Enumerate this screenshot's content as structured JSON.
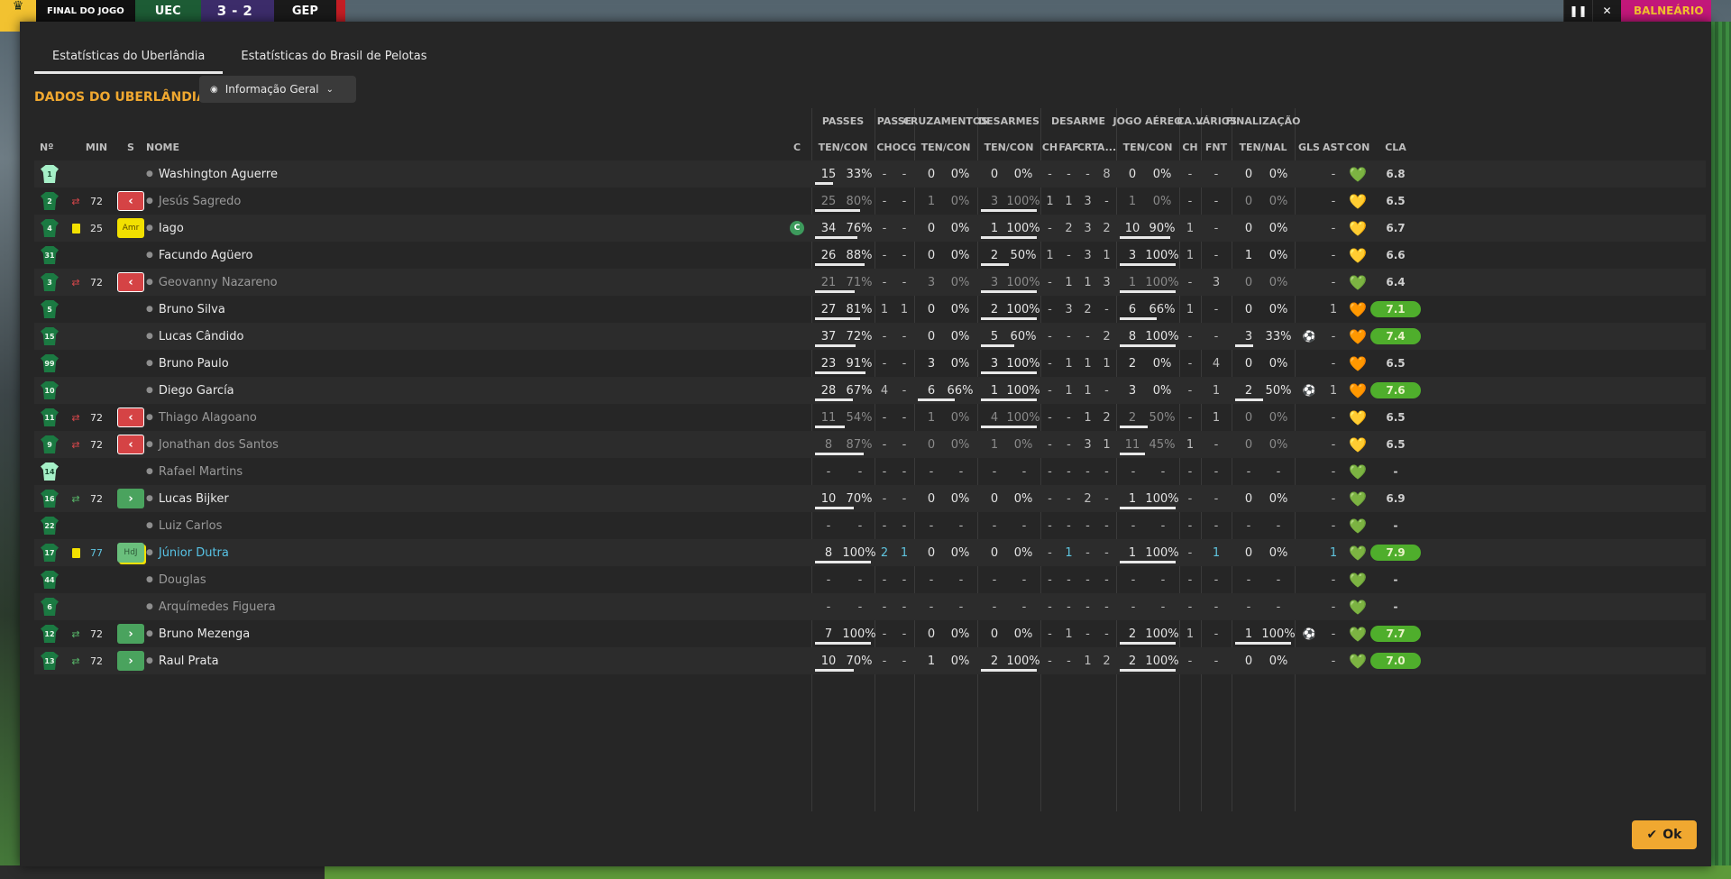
{
  "scorebar": {
    "status": "FINAL DO JOGO",
    "home": "UEC",
    "score": "3-2",
    "away": "GEP",
    "right_label": "BALNEÁRIO"
  },
  "tabs": [
    {
      "label": "Estatísticas do Uberlândia"
    },
    {
      "label": "Estatísticas do Brasil de Pelotas"
    }
  ],
  "section_title": "DADOS DO UBERLÂNDIA",
  "view_select": "Informação Geral",
  "ok_label": "Ok",
  "group_headers": {
    "passes": "PASSES",
    "passe": "PASSE",
    "cruzamentos": "CRUZAMENTOS",
    "desarmes": "DESARMES",
    "desarme": "DESARME",
    "jogo_aereo": "JOGO AÉREO",
    "ca": "CA...",
    "varios": "VÁRIOS",
    "finalizacao": "FINALIZAÇÃO"
  },
  "columns": {
    "num": "Nº",
    "min": "MIN",
    "s": "S",
    "nome": "NOME",
    "c": "C",
    "pas_tc": "TEN/CON",
    "pas_ch": "CH",
    "pas_ocg": "OCG",
    "cru_tc": "TEN/CON",
    "des_tc": "TEN/CON",
    "dm_ch": "CH",
    "dm_faf": "FAF",
    "dm_crt": "CRT",
    "dm_a": "A...",
    "aer_tc": "TEN/CON",
    "ca_ch": "CH",
    "var_fnt": "FNT",
    "fin_tn": "TEN/NAL",
    "gls": "GLS",
    "ast": "AST",
    "con": "CON",
    "cla": "CLA"
  },
  "colors": {
    "accent": "#f0a830",
    "rating_good": "#4fae2c",
    "sub_out": "#d54345",
    "sub_in": "#4aa35e",
    "link": "#57c3e6"
  },
  "rows": [
    {
      "num": "1",
      "gk": true,
      "name": "Washington Aguerre",
      "pt": "15",
      "pp": "33%",
      "pbar": 0.33,
      "pch": "-",
      "pocg": "-",
      "ct": "0",
      "cp": "0%",
      "dt": "0",
      "dp": "0%",
      "dch": "-",
      "dfaf": "-",
      "dcrt": "-",
      "da": "8",
      "at": "0",
      "ap": "0%",
      "cach": "-",
      "fnt": "-",
      "ft": "0",
      "fp": "0%",
      "gls": "",
      "ast": "-",
      "con": "💚",
      "conc": "#3ddc6b",
      "cla": "6.8"
    },
    {
      "num": "2",
      "sub": "out",
      "min": "72",
      "badge": "out",
      "badge_label": "‹",
      "name": "Jesús Sagredo",
      "dim": true,
      "pt": "25",
      "pp": "80%",
      "pbar": 0.8,
      "pch": "-",
      "pocg": "-",
      "ct": "1",
      "cp": "0%",
      "dt": "3",
      "dp": "100%",
      "dbar": 1,
      "dch": "1",
      "dfaf": "1",
      "dcrt": "3",
      "da": "-",
      "at": "1",
      "ap": "0%",
      "cach": "-",
      "fnt": "-",
      "ft": "0",
      "fp": "0%",
      "gls": "",
      "ast": "-",
      "con": "💛",
      "conc": "#b8d93a",
      "cla": "6.5"
    },
    {
      "num": "4",
      "yc": true,
      "min": "25",
      "badge": "amr",
      "badge_label": "Amr",
      "name": "Iago",
      "captain": "C",
      "pt": "34",
      "pp": "76%",
      "pbar": 0.76,
      "pch": "-",
      "pocg": "-",
      "ct": "0",
      "cp": "0%",
      "dt": "1",
      "dp": "100%",
      "dbar": 1,
      "dch": "-",
      "dfaf": "2",
      "dcrt": "3",
      "da": "2",
      "at": "10",
      "ap": "90%",
      "abar": 0.9,
      "cach": "1",
      "fnt": "-",
      "ft": "0",
      "fp": "0%",
      "gls": "",
      "ast": "-",
      "con": "💛",
      "conc": "#d9d838",
      "cla": "6.7"
    },
    {
      "num": "31",
      "name": "Facundo Agüero",
      "pt": "26",
      "pp": "88%",
      "pbar": 0.88,
      "pch": "-",
      "pocg": "-",
      "ct": "0",
      "cp": "0%",
      "dt": "2",
      "dp": "50%",
      "dbar": 0.5,
      "dch": "1",
      "dfaf": "-",
      "dcrt": "3",
      "da": "1",
      "at": "3",
      "ap": "100%",
      "abar": 1,
      "cach": "1",
      "fnt": "-",
      "ft": "1",
      "fp": "0%",
      "gls": "",
      "ast": "-",
      "con": "💛",
      "conc": "#c8d83a",
      "cla": "6.6"
    },
    {
      "num": "3",
      "sub": "out",
      "min": "72",
      "badge": "out",
      "badge_label": "‹",
      "name": "Geovanny Nazareno",
      "dim": true,
      "pt": "21",
      "pp": "71%",
      "pbar": 0.71,
      "pch": "-",
      "pocg": "-",
      "ct": "3",
      "cp": "0%",
      "dt": "3",
      "dp": "100%",
      "dbar": 1,
      "dch": "-",
      "dfaf": "1",
      "dcrt": "1",
      "da": "3",
      "at": "1",
      "ap": "100%",
      "abar": 1,
      "cach": "-",
      "fnt": "3",
      "ft": "0",
      "fp": "0%",
      "gls": "",
      "ast": "-",
      "con": "💚",
      "conc": "#a4d83a",
      "cla": "6.4"
    },
    {
      "num": "5",
      "name": "Bruno Silva",
      "pt": "27",
      "pp": "81%",
      "pbar": 0.81,
      "pch": "1",
      "pocg": "1",
      "ct": "0",
      "cp": "0%",
      "dt": "2",
      "dp": "100%",
      "dbar": 1,
      "dch": "-",
      "dfaf": "3",
      "dcrt": "2",
      "da": "-",
      "at": "6",
      "ap": "66%",
      "abar": 0.66,
      "cach": "1",
      "fnt": "-",
      "ft": "0",
      "fp": "0%",
      "gls": "",
      "ast": "1",
      "con": "🧡",
      "conc": "#c9703a",
      "cla": "7.1",
      "good": true
    },
    {
      "num": "15",
      "name": "Lucas Cândido",
      "pt": "37",
      "pp": "72%",
      "pbar": 0.72,
      "pch": "-",
      "pocg": "-",
      "ct": "0",
      "cp": "0%",
      "dt": "5",
      "dp": "60%",
      "dbar": 0.6,
      "dch": "-",
      "dfaf": "-",
      "dcrt": "-",
      "da": "2",
      "at": "8",
      "ap": "100%",
      "abar": 1,
      "cach": "-",
      "fnt": "-",
      "ft": "3",
      "fp": "33%",
      "fbar": 0.33,
      "gls": "⚽",
      "ast": "-",
      "con": "🧡",
      "conc": "#c9703a",
      "cla": "7.4",
      "good": true
    },
    {
      "num": "99",
      "name": "Bruno Paulo",
      "pt": "23",
      "pp": "91%",
      "pbar": 0.91,
      "pch": "-",
      "pocg": "-",
      "ct": "3",
      "cp": "0%",
      "dt": "3",
      "dp": "100%",
      "dbar": 1,
      "dch": "-",
      "dfaf": "1",
      "dcrt": "1",
      "da": "1",
      "at": "2",
      "ap": "0%",
      "cach": "-",
      "fnt": "4",
      "ft": "0",
      "fp": "0%",
      "gls": "",
      "ast": "-",
      "con": "🧡",
      "conc": "#d8a040",
      "cla": "6.5"
    },
    {
      "num": "10",
      "name": "Diego García",
      "pt": "28",
      "pp": "67%",
      "pbar": 0.67,
      "pch": "4",
      "pocg": "-",
      "ct": "6",
      "cp": "66%",
      "cbar": 0.66,
      "dt": "1",
      "dp": "100%",
      "dbar": 1,
      "dch": "-",
      "dfaf": "1",
      "dcrt": "1",
      "da": "-",
      "at": "3",
      "ap": "0%",
      "cach": "-",
      "fnt": "1",
      "ft": "2",
      "fp": "50%",
      "fbar": 0.5,
      "gls": "⚽",
      "ast": "1",
      "con": "🧡",
      "conc": "#c9703a",
      "cla": "7.6",
      "good": true
    },
    {
      "num": "11",
      "sub": "out",
      "min": "72",
      "badge": "out",
      "badge_label": "‹",
      "name": "Thiago Alagoano",
      "dim": true,
      "pt": "11",
      "pp": "54%",
      "pbar": 0.54,
      "pch": "-",
      "pocg": "-",
      "ct": "1",
      "cp": "0%",
      "dt": "4",
      "dp": "100%",
      "dbar": 1,
      "dch": "-",
      "dfaf": "-",
      "dcrt": "1",
      "da": "2",
      "at": "2",
      "ap": "50%",
      "abar": 0.5,
      "cach": "-",
      "fnt": "1",
      "ft": "0",
      "fp": "0%",
      "gls": "",
      "ast": "-",
      "con": "💛",
      "conc": "#d8b040",
      "cla": "6.5"
    },
    {
      "num": "9",
      "sub": "out",
      "min": "72",
      "badge": "out",
      "badge_label": "‹",
      "name": "Jonathan dos Santos",
      "dim": true,
      "pt": "8",
      "pp": "87%",
      "pbar": 0.87,
      "pch": "-",
      "pocg": "-",
      "ct": "0",
      "cp": "0%",
      "dt": "1",
      "dp": "0%",
      "dch": "-",
      "dfaf": "-",
      "dcrt": "3",
      "da": "1",
      "at": "11",
      "ap": "45%",
      "abar": 0.45,
      "cach": "1",
      "fnt": "-",
      "ft": "0",
      "fp": "0%",
      "gls": "",
      "ast": "-",
      "con": "💛",
      "conc": "#d8b040",
      "cla": "6.5"
    },
    {
      "num": "14",
      "gk": true,
      "name": "Rafael Martins",
      "dim": true,
      "empty": true,
      "con": "💚",
      "conc": "#3ddc6b",
      "cla": "-"
    },
    {
      "num": "16",
      "sub": "in",
      "min": "72",
      "badge": "in",
      "badge_label": "›",
      "name": "Lucas Bijker",
      "pt": "10",
      "pp": "70%",
      "pbar": 0.7,
      "pch": "-",
      "pocg": "-",
      "ct": "0",
      "cp": "0%",
      "dt": "0",
      "dp": "0%",
      "dch": "-",
      "dfaf": "-",
      "dcrt": "2",
      "da": "-",
      "at": "1",
      "ap": "100%",
      "abar": 1,
      "cach": "-",
      "fnt": "-",
      "ft": "0",
      "fp": "0%",
      "gls": "",
      "ast": "-",
      "con": "💚",
      "conc": "#3ddc6b",
      "cla": "6.9"
    },
    {
      "num": "22",
      "name": "Luiz Carlos",
      "dim": true,
      "empty": true,
      "con": "💚",
      "conc": "#3ddc6b",
      "cla": "-"
    },
    {
      "num": "17",
      "yc": true,
      "min": "77",
      "minhi": true,
      "badge": "hdj",
      "badge_label": "HdJ",
      "name": "Júnior Dutra",
      "link": true,
      "pt": "8",
      "pp": "100%",
      "pbar": 1,
      "pch": "2",
      "pocg": "1",
      "hi_pas": true,
      "ct": "0",
      "cp": "0%",
      "dt": "0",
      "dp": "0%",
      "dch": "-",
      "dfaf": "1",
      "dfafhi": true,
      "dcrt": "-",
      "da": "-",
      "at": "1",
      "ap": "100%",
      "abar": 1,
      "cach": "-",
      "fnt": "1",
      "fnthi": true,
      "ft": "0",
      "fp": "0%",
      "gls": "",
      "ast": "1",
      "asthi": true,
      "con": "💚",
      "conc": "#3ddc6b",
      "cla": "7.9",
      "good": true
    },
    {
      "num": "44",
      "name": "Douglas",
      "dim": true,
      "empty": true,
      "con": "💚",
      "conc": "#3ddc6b",
      "cla": "-"
    },
    {
      "num": "6",
      "name": "Arquímedes Figuera",
      "dim": true,
      "empty": true,
      "con": "💚",
      "conc": "#3ddc6b",
      "cla": "-"
    },
    {
      "num": "12",
      "sub": "in",
      "min": "72",
      "badge": "in",
      "badge_label": "›",
      "name": "Bruno Mezenga",
      "pt": "7",
      "pp": "100%",
      "pbar": 1,
      "pch": "-",
      "pocg": "-",
      "ct": "0",
      "cp": "0%",
      "dt": "0",
      "dp": "0%",
      "dch": "-",
      "dfaf": "1",
      "dcrt": "-",
      "da": "-",
      "at": "2",
      "ap": "100%",
      "abar": 1,
      "cach": "1",
      "fnt": "-",
      "ft": "1",
      "fp": "100%",
      "fbar": 1,
      "gls": "⚽",
      "ast": "-",
      "con": "💚",
      "conc": "#3ddc6b",
      "cla": "7.7",
      "good": true
    },
    {
      "num": "13",
      "sub": "in",
      "min": "72",
      "badge": "in",
      "badge_label": "›",
      "name": "Raul Prata",
      "pt": "10",
      "pp": "70%",
      "pbar": 0.7,
      "pch": "-",
      "pocg": "-",
      "ct": "1",
      "cp": "0%",
      "dt": "2",
      "dp": "100%",
      "dbar": 1,
      "dch": "-",
      "dfaf": "-",
      "dcrt": "1",
      "da": "2",
      "at": "2",
      "ap": "100%",
      "abar": 1,
      "cach": "-",
      "fnt": "-",
      "ft": "0",
      "fp": "0%",
      "gls": "",
      "ast": "-",
      "con": "💚",
      "conc": "#3ddc6b",
      "cla": "7.0",
      "good": true
    }
  ]
}
